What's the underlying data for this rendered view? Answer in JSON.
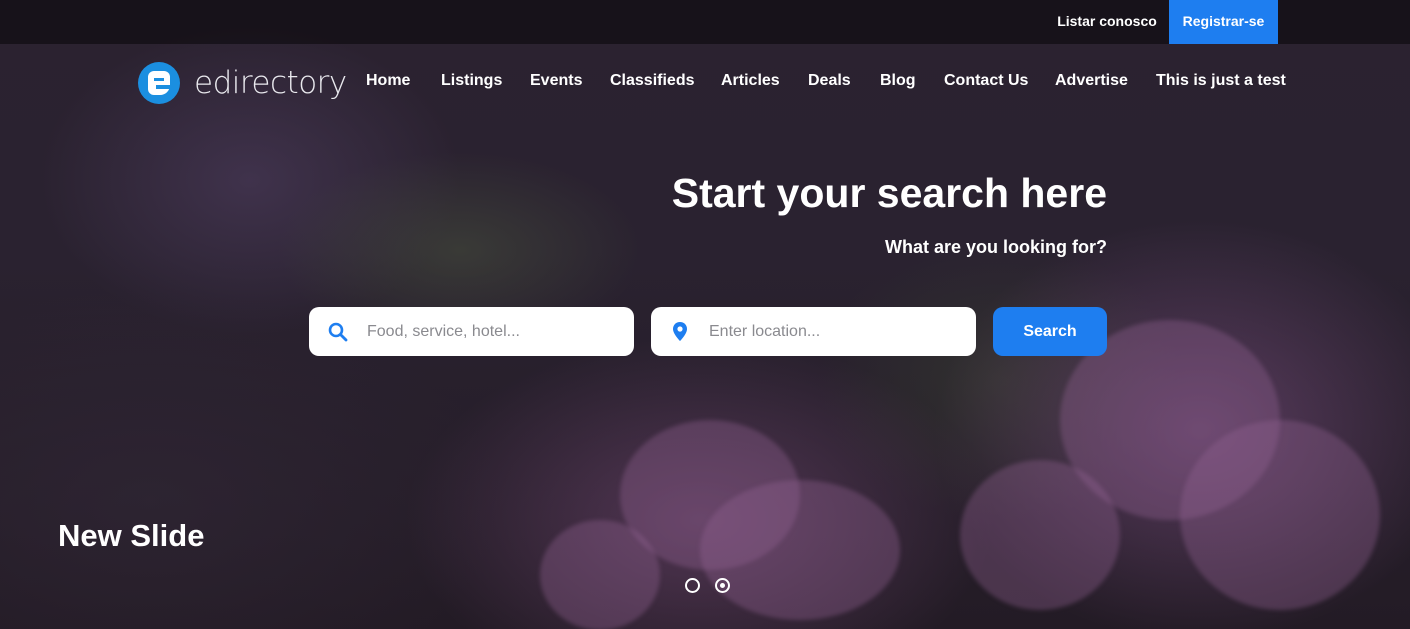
{
  "topbar": {
    "list_label": "Listar conosco",
    "register_label": "Registrar-se"
  },
  "logo": {
    "text": "edirectory"
  },
  "nav": {
    "items": [
      {
        "label": "Home"
      },
      {
        "label": "Listings"
      },
      {
        "label": "Events"
      },
      {
        "label": "Classifieds"
      },
      {
        "label": "Articles"
      },
      {
        "label": "Deals"
      },
      {
        "label": "Blog"
      },
      {
        "label": "Contact Us"
      },
      {
        "label": "Advertise"
      },
      {
        "label": "This is just a test"
      }
    ]
  },
  "hero": {
    "headline": "Start your search here",
    "subline": "What are you looking for?"
  },
  "search": {
    "keyword_placeholder": "Food, service, hotel...",
    "location_placeholder": "Enter location...",
    "button_label": "Search",
    "icons": {
      "keyword": "search-icon",
      "location": "map-pin-icon"
    }
  },
  "slider": {
    "slide_title": "New Slide",
    "dot_count": 2,
    "active_index": 1
  },
  "colors": {
    "accent": "#1e7ef0",
    "logo": "#1b8fe0",
    "text": "#ffffff"
  }
}
